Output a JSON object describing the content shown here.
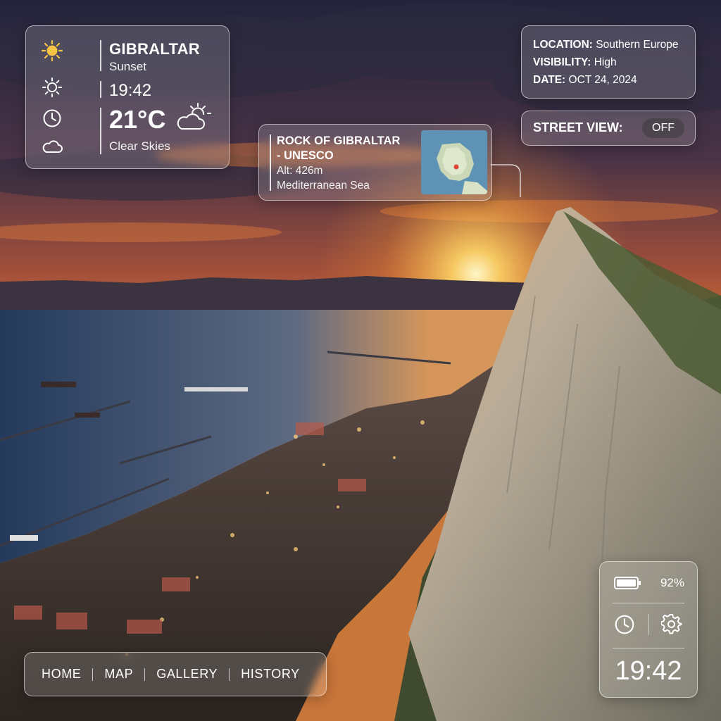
{
  "weather": {
    "city": "GIBRALTAR",
    "period": "Sunset",
    "time": "19:42",
    "temperature": "21°C",
    "condition": "Clear Skies",
    "icons": [
      "sun-icon",
      "sun-outline-icon",
      "clock-icon",
      "cloud-icon",
      "cloud-sun-icon"
    ]
  },
  "info": {
    "location_label": "LOCATION:",
    "location_value": "Southern Europe",
    "visibility_label": "VISIBILITY:",
    "visibility_value": "High",
    "date_label": "DATE:",
    "date_value": "OCT 24, 2024"
  },
  "street_view": {
    "label": "STREET VIEW:",
    "state": "OFF"
  },
  "landmark": {
    "title_line1": "ROCK OF GIBRALTAR",
    "title_line2": "- UNESCO",
    "altitude": "Alt: 426m",
    "sea": "Mediterranean Sea"
  },
  "nav": {
    "items": [
      "HOME",
      "MAP",
      "GALLERY",
      "HISTORY"
    ]
  },
  "status": {
    "battery": "92%",
    "time": "19:42",
    "icons": [
      "battery-icon",
      "clock-icon",
      "gear-icon"
    ]
  },
  "colors": {
    "sky_top": "#2a2b45",
    "sunset_orange": "#f39a2a",
    "sea": "#1f3a5a",
    "rock": "#c9c2b4"
  }
}
